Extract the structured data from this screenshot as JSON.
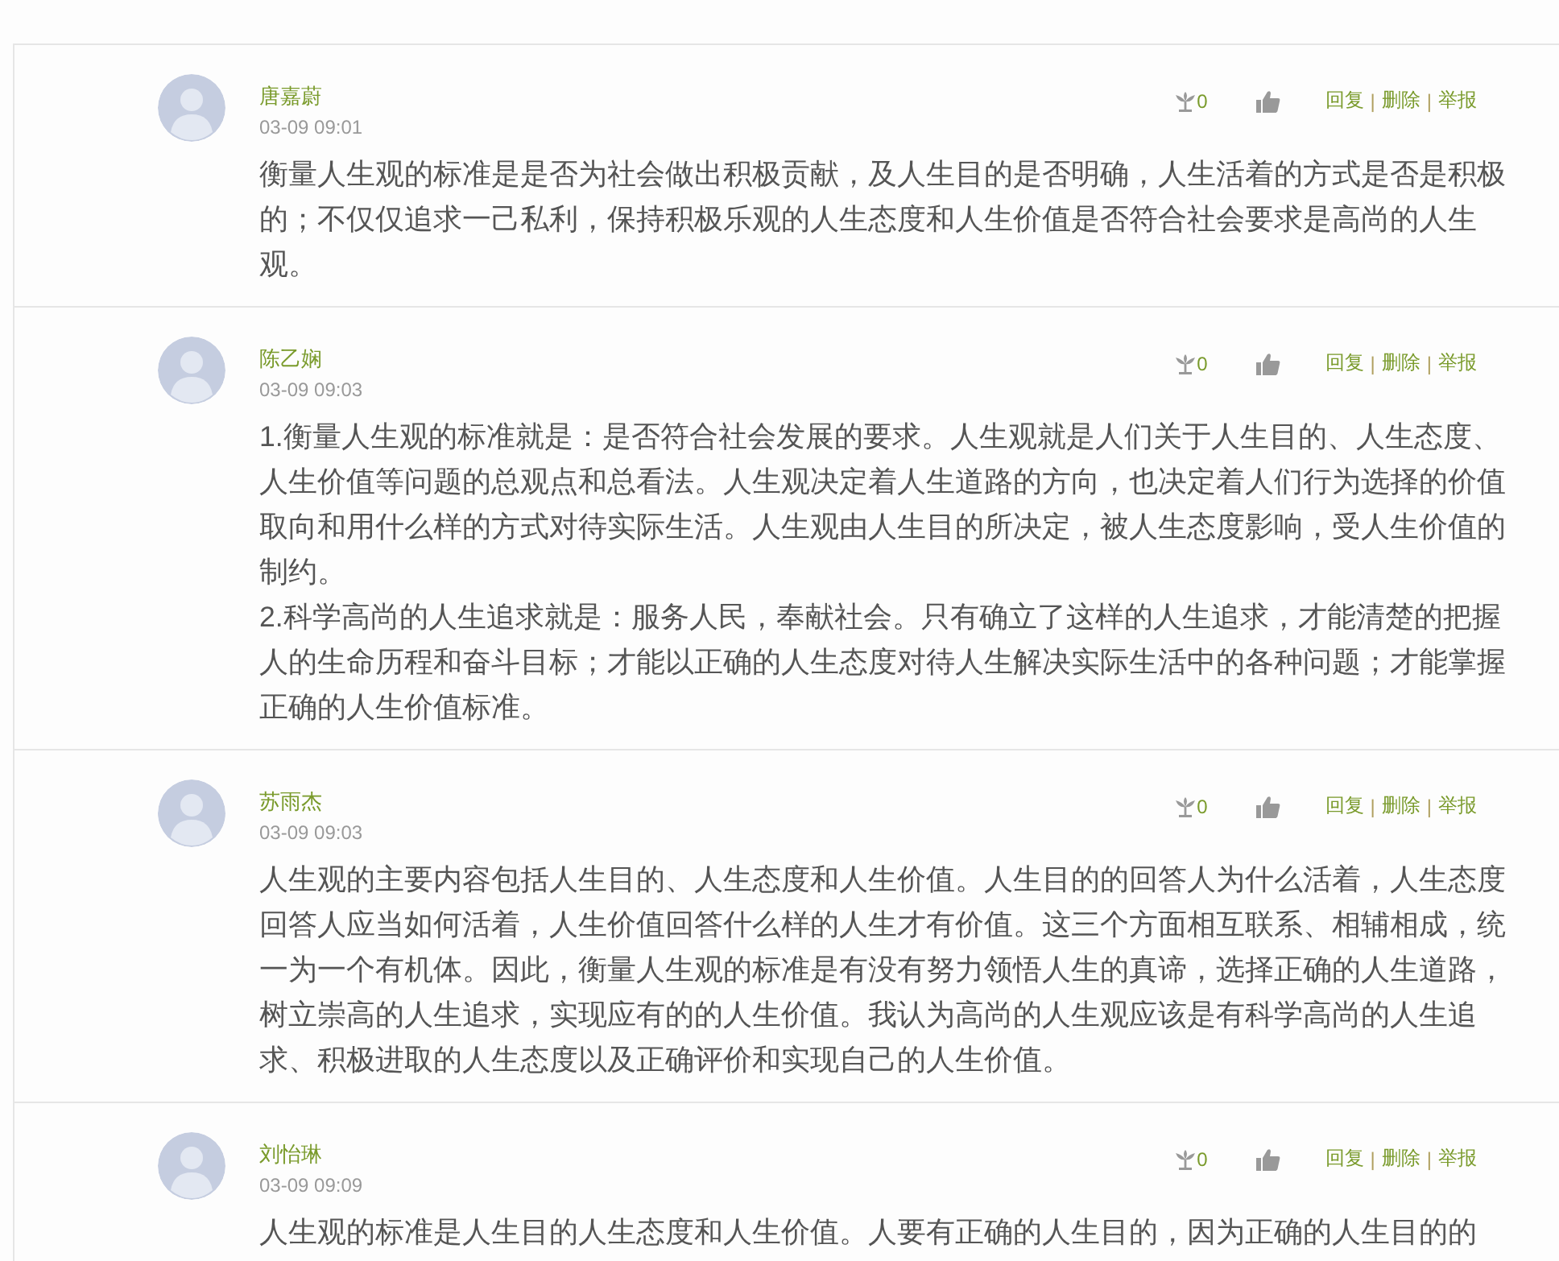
{
  "comments": [
    {
      "name": "唐嘉蔚",
      "time": "03-09 09:01",
      "flower_count": "0",
      "links": [
        {
          "kind": "link",
          "text": "回复"
        },
        {
          "kind": "separator",
          "text": "|"
        },
        {
          "kind": "link",
          "text": "删除"
        },
        {
          "kind": "separator",
          "text": "|"
        },
        {
          "kind": "link",
          "text": "举报"
        }
      ],
      "paragraphs": [
        "衡量人生观的标准是是否为社会做出积极贡献，及人生目的是否明确，人生活着的方式是否是积极的；不仅仅追求一己私利，保持积极乐观的人生态度和人生价值是否符合社会要求是高尚的人生观。"
      ]
    },
    {
      "name": "陈乙娴",
      "time": "03-09 09:03",
      "flower_count": "0",
      "links": [
        {
          "kind": "link",
          "text": "回复"
        },
        {
          "kind": "separator",
          "text": "|"
        },
        {
          "kind": "link",
          "text": "删除"
        },
        {
          "kind": "separator",
          "text": "|"
        },
        {
          "kind": "link",
          "text": "举报"
        }
      ],
      "paragraphs": [
        "1.衡量人生观的标准就是：是否符合社会发展的要求。人生观就是人们关于人生目的、人生态度、人生价值等问题的总观点和总看法。人生观决定着人生道路的方向，也决定着人们行为选择的价值取向和用什么样的方式对待实际生活。人生观由人生目的所决定，被人生态度影响，受人生价值的制约。",
        "2.科学高尚的人生追求就是：服务人民，奉献社会。只有确立了这样的人生追求，才能清楚的把握人的生命历程和奋斗目标；才能以正确的人生态度对待人生解决实际生活中的各种问题；才能掌握正确的人生价值标准。"
      ]
    },
    {
      "name": "苏雨杰",
      "time": "03-09 09:03",
      "flower_count": "0",
      "links": [
        {
          "kind": "link",
          "text": "回复"
        },
        {
          "kind": "separator",
          "text": "|"
        },
        {
          "kind": "link",
          "text": "删除"
        },
        {
          "kind": "separator",
          "text": "|"
        },
        {
          "kind": "link",
          "text": "举报"
        }
      ],
      "paragraphs": [
        "人生观的主要内容包括人生目的、人生态度和人生价值。人生目的的回答人为什么活着，人生态度回答人应当如何活着，人生价值回答什么样的人生才有价值。这三个方面相互联系、相辅相成，统一为一个有机体。因此，衡量人生观的标准是有没有努力领悟人生的真谛，选择正确的人生道路，树立崇高的人生追求，实现应有的的人生价值。我认为高尚的人生观应该是有科学高尚的人生追求、积极进取的人生态度以及正确评价和实现自己的人生价值。"
      ]
    },
    {
      "name": "刘怡琳",
      "time": "03-09 09:09",
      "flower_count": "0",
      "links": [
        {
          "kind": "link",
          "text": "回复"
        },
        {
          "kind": "separator",
          "text": "|"
        },
        {
          "kind": "link",
          "text": "删除"
        },
        {
          "kind": "separator",
          "text": "|"
        },
        {
          "kind": "link",
          "text": "举报"
        }
      ],
      "paragraphs": [
        "人生观的标准是人生目的人生态度和人生价值。人要有正确的人生目的，因为正确的人生目的的"
      ]
    }
  ]
}
